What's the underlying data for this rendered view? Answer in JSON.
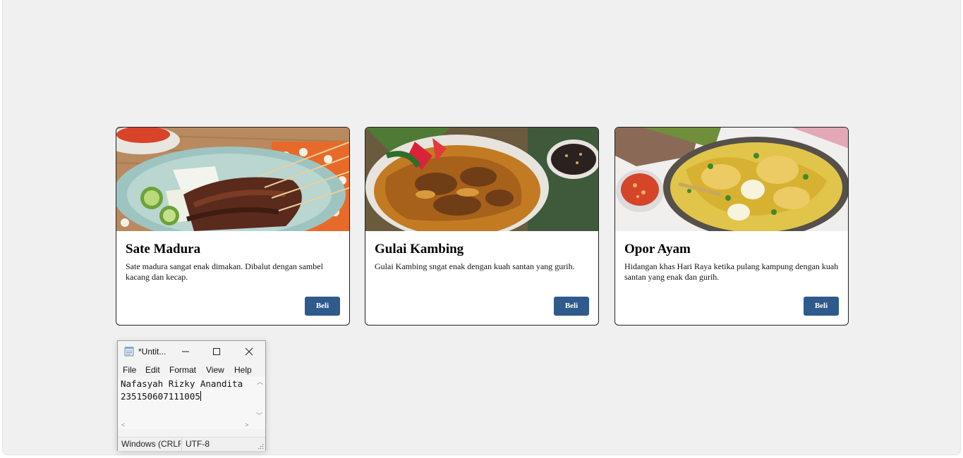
{
  "cards": [
    {
      "title": "Sate Madura",
      "description": "Sate madura sangat enak dimakan. Dibalut dengan sambel kacang dan kecap.",
      "button_label": "Beli",
      "image_alt": "sate-madura-photo"
    },
    {
      "title": "Gulai Kambing",
      "description": "Gulai Kambing sngat enak dengan kuah santan yang gurih.",
      "button_label": "Beli",
      "image_alt": "gulai-kambing-photo"
    },
    {
      "title": "Opor Ayam",
      "description": "Hidangan khas Hari Raya ketika pulang kampung dengan kuah santan yang enak dan gurih.",
      "button_label": "Beli",
      "image_alt": "opor-ayam-photo"
    }
  ],
  "notepad": {
    "title": "*Untit...",
    "menu": [
      "File",
      "Edit",
      "Format",
      "View",
      "Help"
    ],
    "lines": [
      "Nafasyah Rizky Anandita",
      "235150607111005"
    ],
    "status": {
      "line_ending": "Windows (CRLF",
      "encoding": "UTF-8"
    }
  },
  "colors": {
    "button": "#2e5a8c",
    "viewport_bg": "#f0f0f0"
  }
}
